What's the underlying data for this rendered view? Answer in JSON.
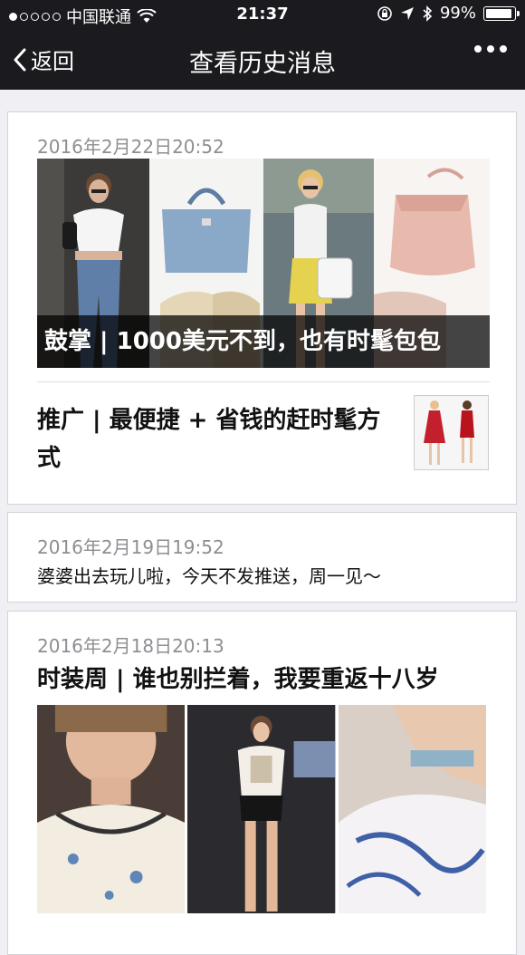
{
  "status_bar": {
    "carrier": "中国联通",
    "time": "21:37",
    "battery": "99%"
  },
  "nav": {
    "back_label": "返回",
    "title": "查看历史消息"
  },
  "messages": [
    {
      "date": "2016年2月22日20:52",
      "cover_caption": "鼓掌 | 1000美元不到，也有时髦包包",
      "sub_title": "推广 | 最便捷 + 省钱的赶时髦方式"
    },
    {
      "date": "2016年2月19日19:52",
      "text": "婆婆出去玩儿啦，今天不发推送，周一见～"
    },
    {
      "date": "2016年2月18日20:13",
      "title": "时装周 | 谁也别拦着，我要重返十八岁"
    }
  ],
  "colors": {
    "bar": "#1b1b1f",
    "background": "#efeff4",
    "date_text": "#8e8e93"
  }
}
